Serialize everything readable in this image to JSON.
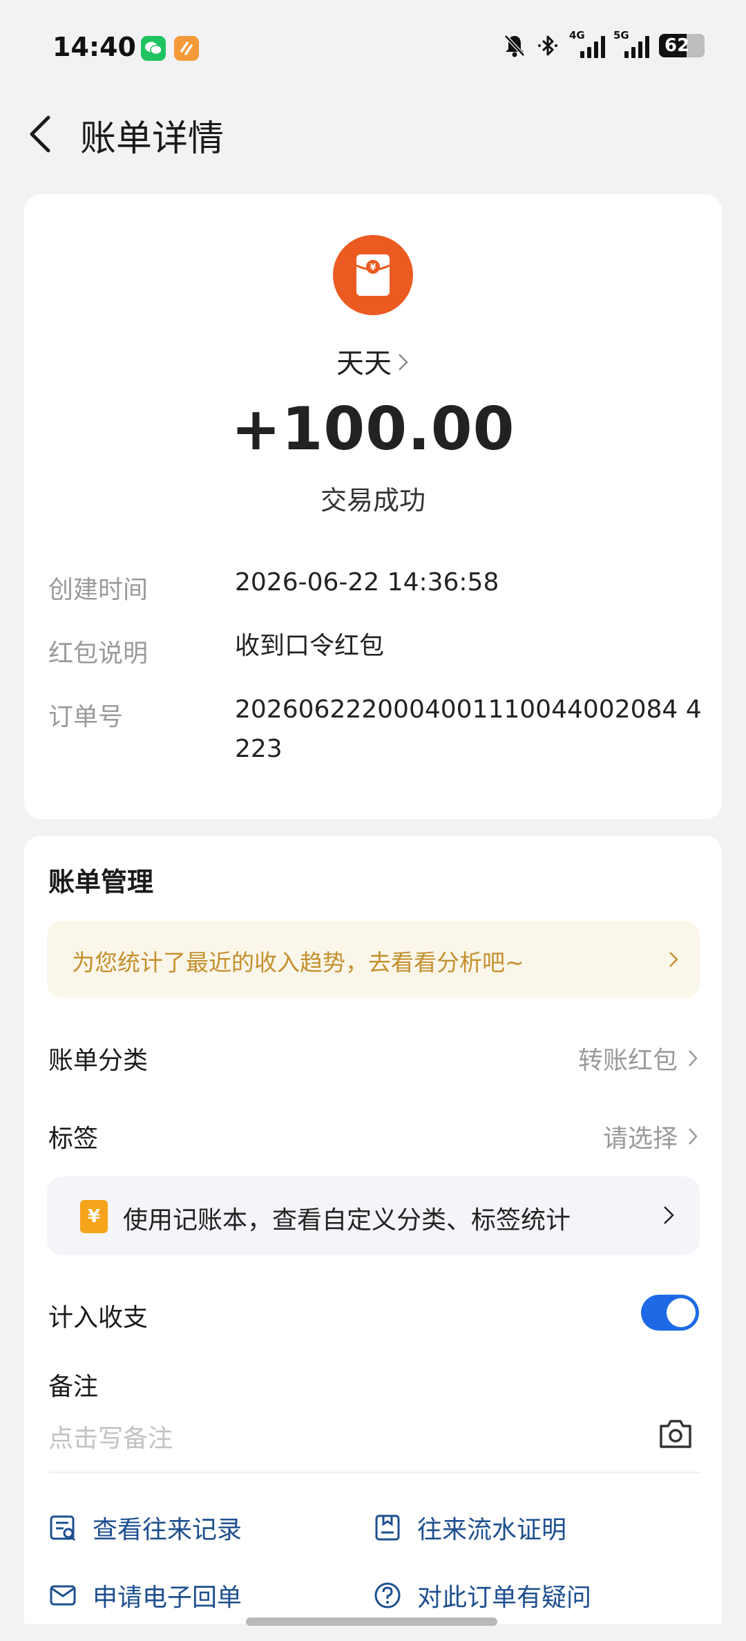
{
  "status_bar": {
    "time": "14:40",
    "net1": "4G",
    "net2": "5G",
    "battery": "62"
  },
  "header": {
    "title": "账单详情"
  },
  "transaction": {
    "payer": "天天",
    "amount": "+100.00",
    "status": "交易成功",
    "details": [
      {
        "label": "创建时间",
        "value": "2026-06-22 14:36:58"
      },
      {
        "label": "红包说明",
        "value": "收到口令红包"
      },
      {
        "label": "订单号",
        "value": "2026062220004001110044002084 4223"
      }
    ]
  },
  "management": {
    "title": "账单管理",
    "promo_text": "为您统计了最近的收入趋势，去看看分析吧~",
    "category": {
      "label": "账单分类",
      "value": "转账红包"
    },
    "tag": {
      "label": "标签",
      "value": "请选择"
    },
    "book_promo": {
      "icon_text": "¥",
      "text": "使用记账本，查看自定义分类、标签统计"
    },
    "include": {
      "label": "计入收支",
      "enabled": true
    },
    "remark": {
      "label": "备注",
      "placeholder": "点击写备注"
    },
    "links": {
      "records": "查看往来记录",
      "proof": "往来流水证明",
      "receipt": "申请电子回单",
      "question": "对此订单有疑问"
    }
  },
  "colors": {
    "accent": "#1e6ae6",
    "red_packet": "#eb5a20",
    "promo_text": "#c4902d",
    "link": "#1d4f8f"
  }
}
